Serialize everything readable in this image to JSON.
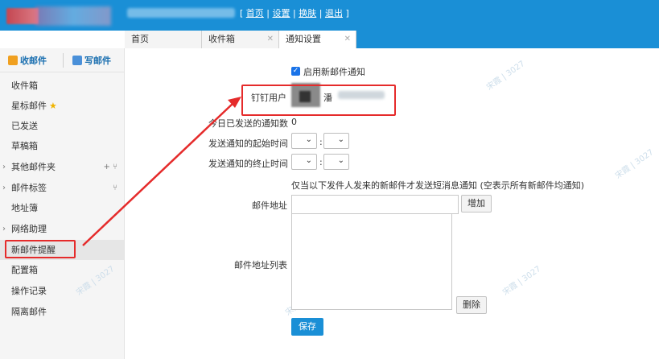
{
  "header": {
    "links_prefix": "[",
    "links": [
      "首页",
      "设置",
      "换肤",
      "退出"
    ],
    "separator": "|",
    "links_suffix": "]"
  },
  "tabs": [
    {
      "label": "首页",
      "closable": false
    },
    {
      "label": "收件箱",
      "closable": true
    },
    {
      "label": "通知设置",
      "closable": true,
      "active": true
    }
  ],
  "sidebar": {
    "receive_label": "收邮件",
    "write_label": "写邮件",
    "items": [
      {
        "label": "收件箱"
      },
      {
        "label": "星标邮件",
        "icon": "star-icon"
      },
      {
        "label": "已发送"
      },
      {
        "label": "草稿箱"
      },
      {
        "label": "其他邮件夹",
        "expandable": true,
        "tail": "+  ⑂"
      },
      {
        "label": "邮件标签",
        "expandable": true,
        "tail": "⑂"
      },
      {
        "label": "地址簿"
      },
      {
        "label": "网络助理",
        "expandable": true
      },
      {
        "label": "新邮件提醒",
        "selected": true
      },
      {
        "label": "配置箱"
      },
      {
        "label": "操作记录"
      },
      {
        "label": "隔离邮件"
      }
    ]
  },
  "form": {
    "enable_label": "启用新邮件通知",
    "enable_checked": true,
    "dingtalk_label": "钉钉用户",
    "user_name_prefix": "潘",
    "sent_count_label": "今日已发送的通知数",
    "sent_count_value": "0",
    "start_time_label": "发送通知的起始时间",
    "end_time_label": "发送通知的终止时间",
    "time_colon": ":",
    "note": "仅当以下发件人发来的新邮件才发送短消息通知 (空表示所有新邮件均通知)",
    "address_label": "邮件地址",
    "add_button": "增加",
    "address_list_label": "邮件地址列表",
    "delete_button": "删除",
    "save_button": "保存"
  },
  "watermark": {
    "text": "宋霞 | 3027"
  },
  "colors": {
    "header_blue": "#1a8fd6",
    "annotation_red": "#e52b2b",
    "checkbox_blue": "#1a73e8"
  }
}
